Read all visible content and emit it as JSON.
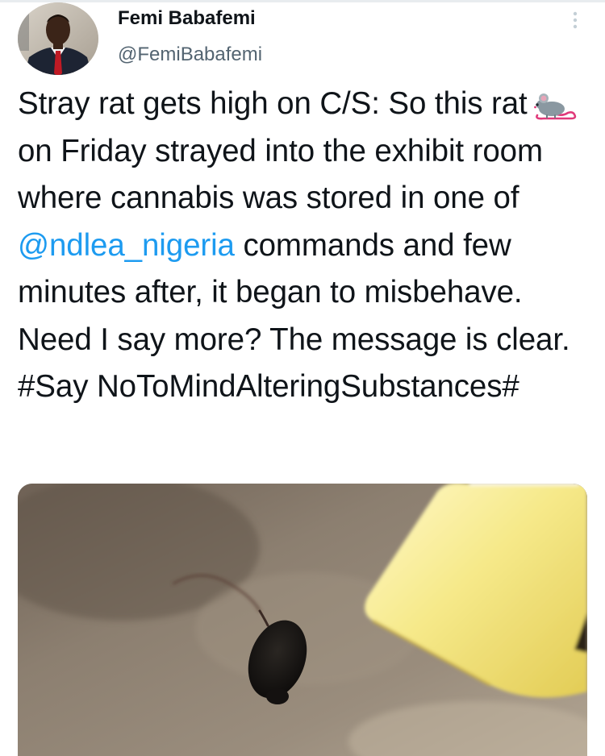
{
  "tweet": {
    "author": {
      "display_name": "Femi Babafemi",
      "handle": "@FemiBabafemi"
    },
    "more_icon": "more-vertical-icon",
    "text": {
      "part1": "Stray rat gets high on C/S: So this rat",
      "emoji": "rat-emoji",
      "part2": " on Friday strayed into the exhibit room where cannabis was stored in one of ",
      "mention": "@ndlea_nigeria",
      "part3": " commands and few minutes after, it began to misbehave. Need I say more? The message is clear. #Say NoToMindAlteringSubstances#"
    },
    "media": {
      "type": "video-still",
      "subject": "rat-on-floor-next-to-yellow-container"
    }
  },
  "colors": {
    "text": "#0f1419",
    "secondary_text": "#536471",
    "link": "#1d9bf0",
    "divider": "#e8ecef"
  }
}
